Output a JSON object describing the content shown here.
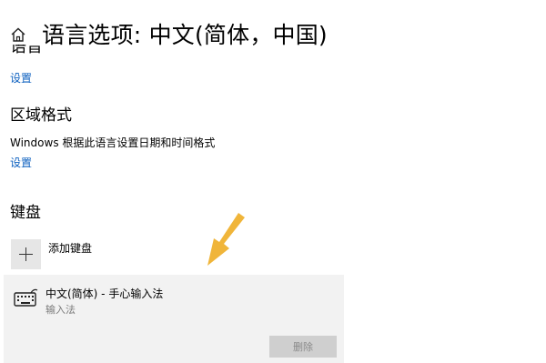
{
  "header": {
    "title": "语言选项: 中文(简体，中国)",
    "home_icon": "home-icon"
  },
  "speech_section": {
    "cutoff_heading": "语音",
    "settings_link": "设置"
  },
  "region_section": {
    "title": "区域格式",
    "description": "Windows 根据此语言设置日期和时间格式",
    "settings_link": "设置"
  },
  "keyboard_section": {
    "title": "键盘",
    "add_label": "添加键盘",
    "items": [
      {
        "name": "中文(简体) - 手心输入法",
        "subtitle": "输入法",
        "remove_label": "删除",
        "icon": "keyboard-icon"
      }
    ]
  },
  "colors": {
    "link": "#0b5fbf",
    "arrow": "#f0b53a",
    "item_bg": "#f2f2f2"
  }
}
